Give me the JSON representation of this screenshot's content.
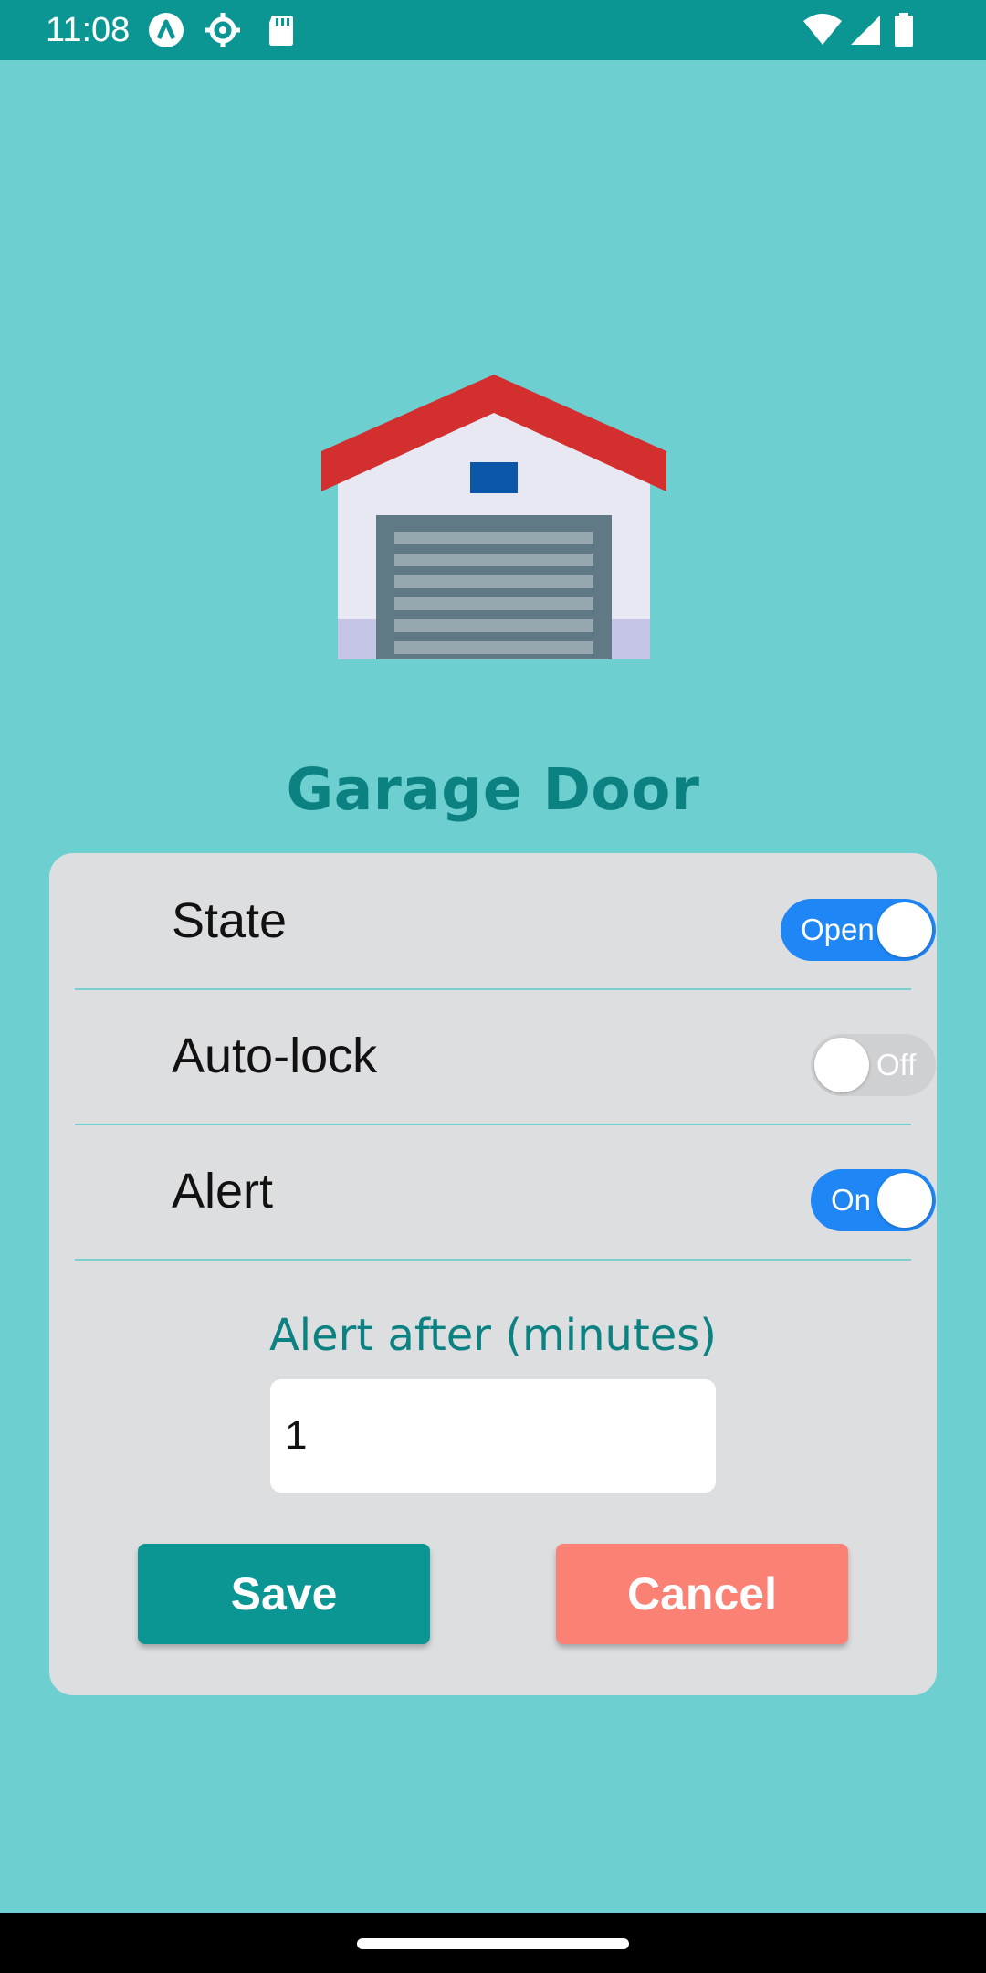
{
  "status_bar": {
    "time": "11:08",
    "left_icons": [
      "a-circle-icon",
      "gear-icon",
      "sd-card-icon"
    ],
    "right_icons": [
      "wifi-icon",
      "signal-icon",
      "battery-icon"
    ]
  },
  "illustration": {
    "name": "garage-icon",
    "roof_color": "#d32f2f",
    "door_color": "#607d8b"
  },
  "title": "Garage Door",
  "settings": {
    "state": {
      "label": "State",
      "toggle_text": "Open",
      "on": true
    },
    "auto_lock": {
      "label": "Auto-lock",
      "toggle_text": "Off",
      "on": false
    },
    "alert": {
      "label": "Alert",
      "toggle_text": "On",
      "on": true
    }
  },
  "alert_after": {
    "label": "Alert after (minutes)",
    "value": "1"
  },
  "buttons": {
    "save": "Save",
    "cancel": "Cancel"
  },
  "colors": {
    "background": "#6dcfd0",
    "primary": "#0b9694",
    "toggle_on": "#1e86f5",
    "cancel": "#fa8174"
  }
}
